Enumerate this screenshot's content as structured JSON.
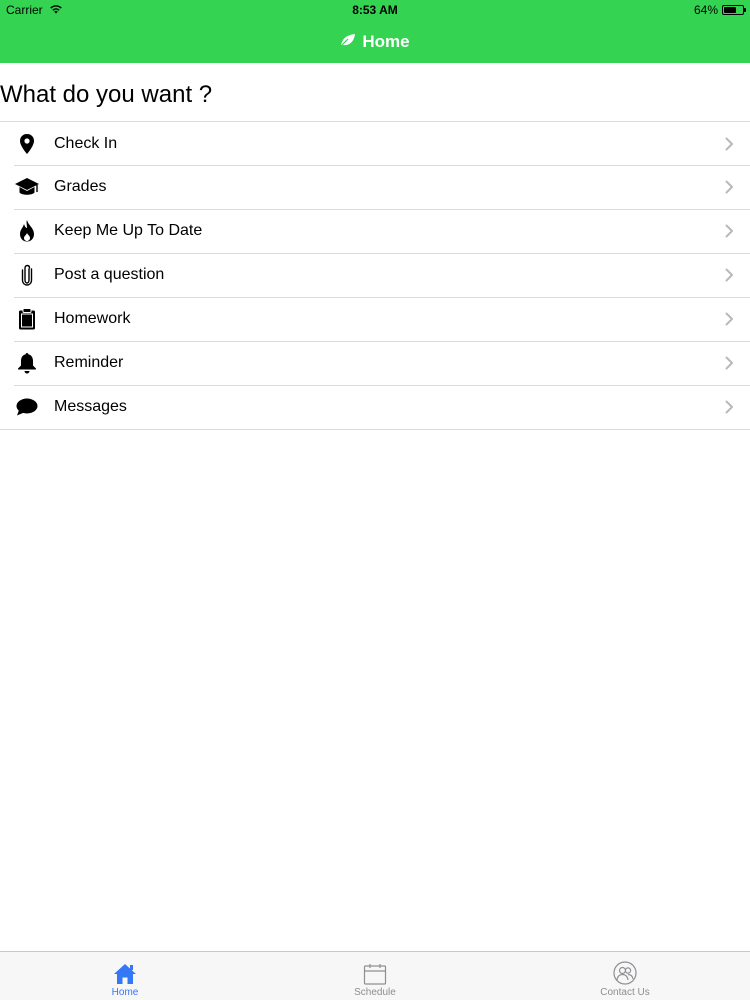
{
  "status_bar": {
    "carrier": "Carrier",
    "time": "8:53 AM",
    "battery": "64%",
    "battery_level": 0.64
  },
  "nav": {
    "title": "Home",
    "icon": "leaf-icon"
  },
  "main": {
    "title": "What do you want ?",
    "items": [
      {
        "label": "Check In",
        "icon": "map-pin-icon"
      },
      {
        "label": "Grades",
        "icon": "graduation-cap-icon"
      },
      {
        "label": "Keep Me Up To Date",
        "icon": "flame-icon"
      },
      {
        "label": "Post a question",
        "icon": "paperclip-icon"
      },
      {
        "label": "Homework",
        "icon": "clipboard-icon"
      },
      {
        "label": "Reminder",
        "icon": "bell-icon"
      },
      {
        "label": "Messages",
        "icon": "speech-bubble-icon"
      }
    ]
  },
  "tab_bar": {
    "tabs": [
      {
        "label": "Home",
        "icon": "house-icon",
        "active": true
      },
      {
        "label": "Schedule",
        "icon": "calendar-icon",
        "active": false
      },
      {
        "label": "Contact Us",
        "icon": "contacts-icon",
        "active": false
      }
    ]
  },
  "colors": {
    "header_green": "#34d352",
    "active_tab_blue": "#3478f6",
    "inactive_tab_gray": "#8e8e93"
  }
}
